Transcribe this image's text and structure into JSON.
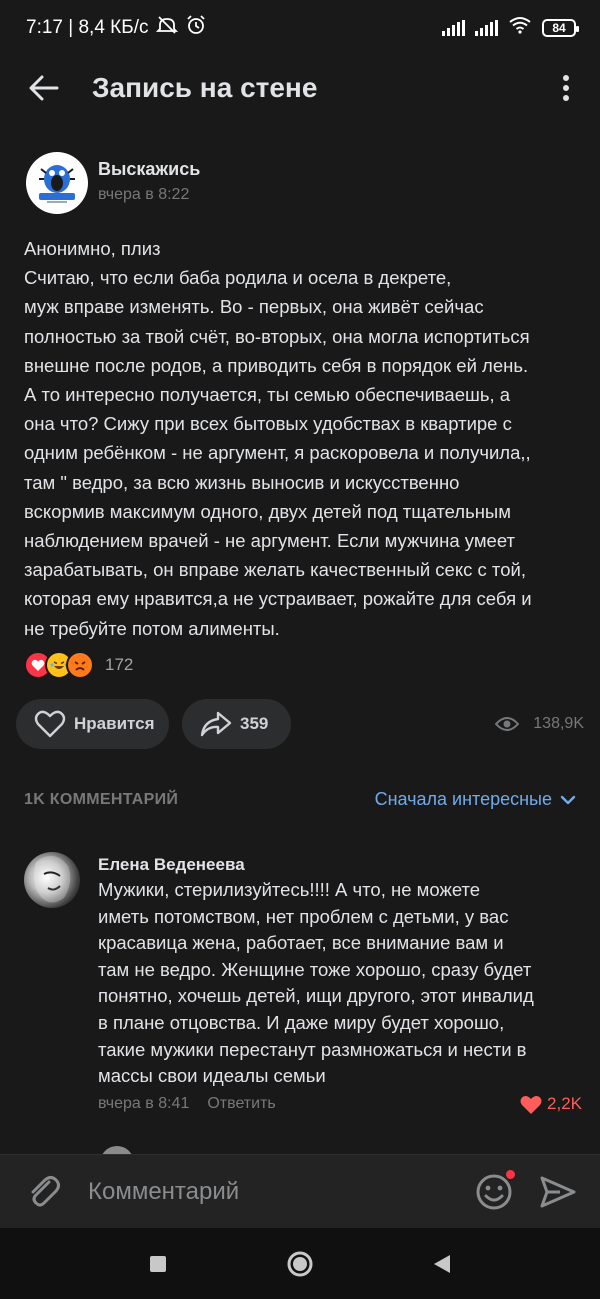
{
  "status_bar": {
    "time_speed": "7:17 | 8,4 КБ/с",
    "battery": "84"
  },
  "app_bar": {
    "title": "Запись на стене"
  },
  "post": {
    "group_name": "Выскажись",
    "time": "вчера в 8:22",
    "text": "Анонимно, плиз\nСчитаю, что если баба родила и осела в декрете,\nмуж вправе изменять. Во - первых, она живёт сейчас\nполностью за твой счёт, во-вторых, она могла испортиться\nвнешне после родов, а приводить себя в порядок ей лень.\nА то интересно получается, ты семью обеспечиваешь, а\nона что? Сижу при всех бытовых удобствах в квартире с\nодним ребёнком - не аргумент, я раскоровела и получила,,\nтам \" ведро, за всю жизнь выносив и искусственно\nвскормив максимум одного, двух детей под тщательным\nнаблюдением врачей - не аргумент. Если мужчина умеет\nзарабатывать, он вправе желать качественный секс с той,\nкоторая ему нравится,а не устраивает, рожайте для себя и\nне требуйте потом алименты.",
    "reactions_count": "172",
    "like_label": "Нравится",
    "shares": "359",
    "views": "138,9K"
  },
  "comments": {
    "count_label": "1K КОММЕНТАРИЙ",
    "sort_label": "Сначала интересные",
    "items": [
      {
        "author": "Елена Веденеева",
        "text": "Мужики, стерилизуйтесь!!!! А что, не можете\nиметь потомством, нет проблем с детьми, у вас\nкрасавица жена, работает, все внимание вам и\nтам не ведро. Женщине тоже хорошо, сразу будет\nпонятно, хочешь детей, ищи другого, этот инвалид\nв плане отцовства. И даже миру будет хорошо,\nтакие мужики перестанут размножаться и нести в\nмассы свои идеалы семьи",
        "time": "вчера в 8:41",
        "reply_label": "Ответить",
        "likes": "2,2K"
      }
    ]
  },
  "composer": {
    "placeholder": "Комментарий"
  },
  "colors": {
    "background": "#19191a",
    "accent_link": "#71aaeb",
    "like_red": "#ff5c5c"
  },
  "icons": [
    "back-arrow-icon",
    "more-vertical-icon",
    "heart-icon",
    "share-icon",
    "eye-icon",
    "chevron-down-icon",
    "paperclip-icon",
    "emoji-icon",
    "send-icon",
    "square-icon",
    "circle-icon",
    "triangle-back-icon"
  ]
}
